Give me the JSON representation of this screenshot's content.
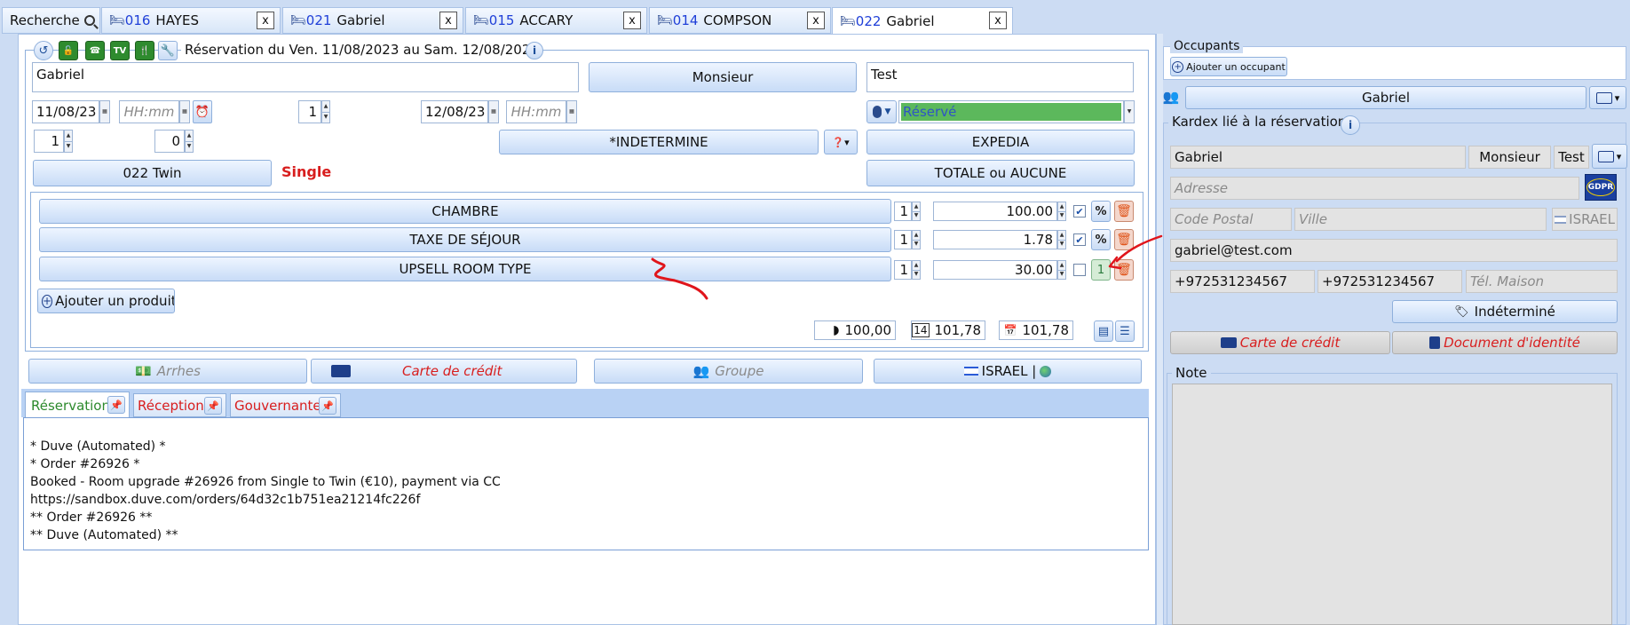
{
  "tabs": [
    {
      "label": "Recherche",
      "icon": "search-icon"
    },
    {
      "num": "016",
      "name": "HAYES",
      "close": "x"
    },
    {
      "num": "021",
      "name": "Gabriel",
      "close": "x"
    },
    {
      "num": "015",
      "name": "ACCARY",
      "close": "x"
    },
    {
      "num": "014",
      "name": "COMPSON",
      "close": "x"
    },
    {
      "num": "022",
      "name": "Gabriel",
      "close": "x"
    }
  ],
  "reservation": {
    "title": "Réservation du Ven. 11/08/2023 au Sam. 12/08/2023",
    "toolbar_icons": [
      "history-icon",
      "unlock-icon",
      "phone-icon",
      "tv-icon",
      "restaurant-icon",
      "wrench-icon"
    ],
    "first_name": "Gabriel",
    "civility": "Monsieur",
    "last_name": "Test",
    "arrival_date": "11/08/23",
    "arrival_time_placeholder": "HH:mm",
    "nights": "1",
    "departure_date": "12/08/23",
    "departure_time_placeholder": "HH:mm",
    "status": "Réservé",
    "status_color": "#5cb85c",
    "adults": "1",
    "children": "0",
    "origin": "*INDETERMINE",
    "channel": "EXPEDIA",
    "room": "022 Twin",
    "room_type": "Single",
    "payment": "TOTALE ou AUCUNE"
  },
  "products": [
    {
      "name": "CHAMBRE",
      "qty": "1",
      "price": "100.00",
      "checked": true,
      "action": "%"
    },
    {
      "name": "TAXE DE SÉJOUR",
      "qty": "1",
      "price": "1.78",
      "checked": true,
      "action": "%"
    },
    {
      "name": "UPSELL ROOM TYPE",
      "qty": "1",
      "price": "30.00",
      "checked": false,
      "action": "1"
    }
  ],
  "add_product": "Ajouter un produit",
  "totals": {
    "t1": "100,00",
    "t2": "101,78",
    "t3": "101,78"
  },
  "bottom_buttons": {
    "arrhes": "Arrhes",
    "card": "Carte de crédit",
    "group": "Groupe",
    "country": "ISRAEL |"
  },
  "note_tabs": [
    "Réservation",
    "Réception",
    "Gouvernante"
  ],
  "notes": [
    "* Duve (Automated) *",
    "* Order #26926 *",
    "Booked - Room upgrade #26926 from Single to Twin (€10), payment via CC",
    "https://sandbox.duve.com/orders/64d32c1b751ea21214fc226f",
    "** Order #26926 **",
    "** Duve (Automated) **"
  ],
  "occupants": {
    "title": "Occupants",
    "add": "Ajouter un occupant",
    "selected": "Gabriel"
  },
  "kardex": {
    "title": "Kardex lié à la réservation",
    "first_name": "Gabriel",
    "civility": "Monsieur",
    "last_name": "Test",
    "address_placeholder": "Adresse",
    "gdpr": "GDPR",
    "postal_placeholder": "Code Postal",
    "city_placeholder": "Ville",
    "country": "ISRAEL",
    "email": "gabriel@test.com",
    "phone1": "+972531234567",
    "phone2": "+972531234567",
    "home_phone_placeholder": "Tél. Maison",
    "category": "Indéterminé",
    "card": "Carte de crédit",
    "id_doc": "Document d'identité",
    "note_title": "Note"
  },
  "annotation_color": "#e0151b"
}
